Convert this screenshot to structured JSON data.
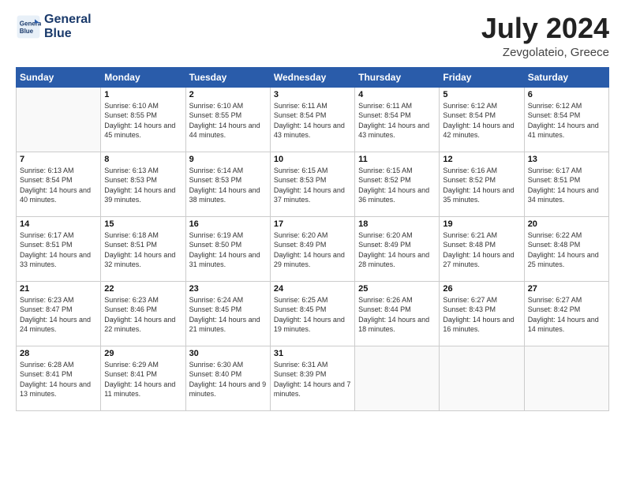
{
  "logo": {
    "line1": "General",
    "line2": "Blue"
  },
  "title": "July 2024",
  "location": "Zevgolateio, Greece",
  "headers": [
    "Sunday",
    "Monday",
    "Tuesday",
    "Wednesday",
    "Thursday",
    "Friday",
    "Saturday"
  ],
  "weeks": [
    [
      {
        "num": "",
        "sunrise": "",
        "sunset": "",
        "daylight": "",
        "empty": true
      },
      {
        "num": "1",
        "sunrise": "Sunrise: 6:10 AM",
        "sunset": "Sunset: 8:55 PM",
        "daylight": "Daylight: 14 hours and 45 minutes."
      },
      {
        "num": "2",
        "sunrise": "Sunrise: 6:10 AM",
        "sunset": "Sunset: 8:55 PM",
        "daylight": "Daylight: 14 hours and 44 minutes."
      },
      {
        "num": "3",
        "sunrise": "Sunrise: 6:11 AM",
        "sunset": "Sunset: 8:54 PM",
        "daylight": "Daylight: 14 hours and 43 minutes."
      },
      {
        "num": "4",
        "sunrise": "Sunrise: 6:11 AM",
        "sunset": "Sunset: 8:54 PM",
        "daylight": "Daylight: 14 hours and 43 minutes."
      },
      {
        "num": "5",
        "sunrise": "Sunrise: 6:12 AM",
        "sunset": "Sunset: 8:54 PM",
        "daylight": "Daylight: 14 hours and 42 minutes."
      },
      {
        "num": "6",
        "sunrise": "Sunrise: 6:12 AM",
        "sunset": "Sunset: 8:54 PM",
        "daylight": "Daylight: 14 hours and 41 minutes."
      }
    ],
    [
      {
        "num": "7",
        "sunrise": "Sunrise: 6:13 AM",
        "sunset": "Sunset: 8:54 PM",
        "daylight": "Daylight: 14 hours and 40 minutes."
      },
      {
        "num": "8",
        "sunrise": "Sunrise: 6:13 AM",
        "sunset": "Sunset: 8:53 PM",
        "daylight": "Daylight: 14 hours and 39 minutes."
      },
      {
        "num": "9",
        "sunrise": "Sunrise: 6:14 AM",
        "sunset": "Sunset: 8:53 PM",
        "daylight": "Daylight: 14 hours and 38 minutes."
      },
      {
        "num": "10",
        "sunrise": "Sunrise: 6:15 AM",
        "sunset": "Sunset: 8:53 PM",
        "daylight": "Daylight: 14 hours and 37 minutes."
      },
      {
        "num": "11",
        "sunrise": "Sunrise: 6:15 AM",
        "sunset": "Sunset: 8:52 PM",
        "daylight": "Daylight: 14 hours and 36 minutes."
      },
      {
        "num": "12",
        "sunrise": "Sunrise: 6:16 AM",
        "sunset": "Sunset: 8:52 PM",
        "daylight": "Daylight: 14 hours and 35 minutes."
      },
      {
        "num": "13",
        "sunrise": "Sunrise: 6:17 AM",
        "sunset": "Sunset: 8:51 PM",
        "daylight": "Daylight: 14 hours and 34 minutes."
      }
    ],
    [
      {
        "num": "14",
        "sunrise": "Sunrise: 6:17 AM",
        "sunset": "Sunset: 8:51 PM",
        "daylight": "Daylight: 14 hours and 33 minutes."
      },
      {
        "num": "15",
        "sunrise": "Sunrise: 6:18 AM",
        "sunset": "Sunset: 8:51 PM",
        "daylight": "Daylight: 14 hours and 32 minutes."
      },
      {
        "num": "16",
        "sunrise": "Sunrise: 6:19 AM",
        "sunset": "Sunset: 8:50 PM",
        "daylight": "Daylight: 14 hours and 31 minutes."
      },
      {
        "num": "17",
        "sunrise": "Sunrise: 6:20 AM",
        "sunset": "Sunset: 8:49 PM",
        "daylight": "Daylight: 14 hours and 29 minutes."
      },
      {
        "num": "18",
        "sunrise": "Sunrise: 6:20 AM",
        "sunset": "Sunset: 8:49 PM",
        "daylight": "Daylight: 14 hours and 28 minutes."
      },
      {
        "num": "19",
        "sunrise": "Sunrise: 6:21 AM",
        "sunset": "Sunset: 8:48 PM",
        "daylight": "Daylight: 14 hours and 27 minutes."
      },
      {
        "num": "20",
        "sunrise": "Sunrise: 6:22 AM",
        "sunset": "Sunset: 8:48 PM",
        "daylight": "Daylight: 14 hours and 25 minutes."
      }
    ],
    [
      {
        "num": "21",
        "sunrise": "Sunrise: 6:23 AM",
        "sunset": "Sunset: 8:47 PM",
        "daylight": "Daylight: 14 hours and 24 minutes."
      },
      {
        "num": "22",
        "sunrise": "Sunrise: 6:23 AM",
        "sunset": "Sunset: 8:46 PM",
        "daylight": "Daylight: 14 hours and 22 minutes."
      },
      {
        "num": "23",
        "sunrise": "Sunrise: 6:24 AM",
        "sunset": "Sunset: 8:45 PM",
        "daylight": "Daylight: 14 hours and 21 minutes."
      },
      {
        "num": "24",
        "sunrise": "Sunrise: 6:25 AM",
        "sunset": "Sunset: 8:45 PM",
        "daylight": "Daylight: 14 hours and 19 minutes."
      },
      {
        "num": "25",
        "sunrise": "Sunrise: 6:26 AM",
        "sunset": "Sunset: 8:44 PM",
        "daylight": "Daylight: 14 hours and 18 minutes."
      },
      {
        "num": "26",
        "sunrise": "Sunrise: 6:27 AM",
        "sunset": "Sunset: 8:43 PM",
        "daylight": "Daylight: 14 hours and 16 minutes."
      },
      {
        "num": "27",
        "sunrise": "Sunrise: 6:27 AM",
        "sunset": "Sunset: 8:42 PM",
        "daylight": "Daylight: 14 hours and 14 minutes."
      }
    ],
    [
      {
        "num": "28",
        "sunrise": "Sunrise: 6:28 AM",
        "sunset": "Sunset: 8:41 PM",
        "daylight": "Daylight: 14 hours and 13 minutes."
      },
      {
        "num": "29",
        "sunrise": "Sunrise: 6:29 AM",
        "sunset": "Sunset: 8:41 PM",
        "daylight": "Daylight: 14 hours and 11 minutes."
      },
      {
        "num": "30",
        "sunrise": "Sunrise: 6:30 AM",
        "sunset": "Sunset: 8:40 PM",
        "daylight": "Daylight: 14 hours and 9 minutes."
      },
      {
        "num": "31",
        "sunrise": "Sunrise: 6:31 AM",
        "sunset": "Sunset: 8:39 PM",
        "daylight": "Daylight: 14 hours and 7 minutes."
      },
      {
        "num": "",
        "sunrise": "",
        "sunset": "",
        "daylight": "",
        "empty": true
      },
      {
        "num": "",
        "sunrise": "",
        "sunset": "",
        "daylight": "",
        "empty": true
      },
      {
        "num": "",
        "sunrise": "",
        "sunset": "",
        "daylight": "",
        "empty": true
      }
    ]
  ]
}
